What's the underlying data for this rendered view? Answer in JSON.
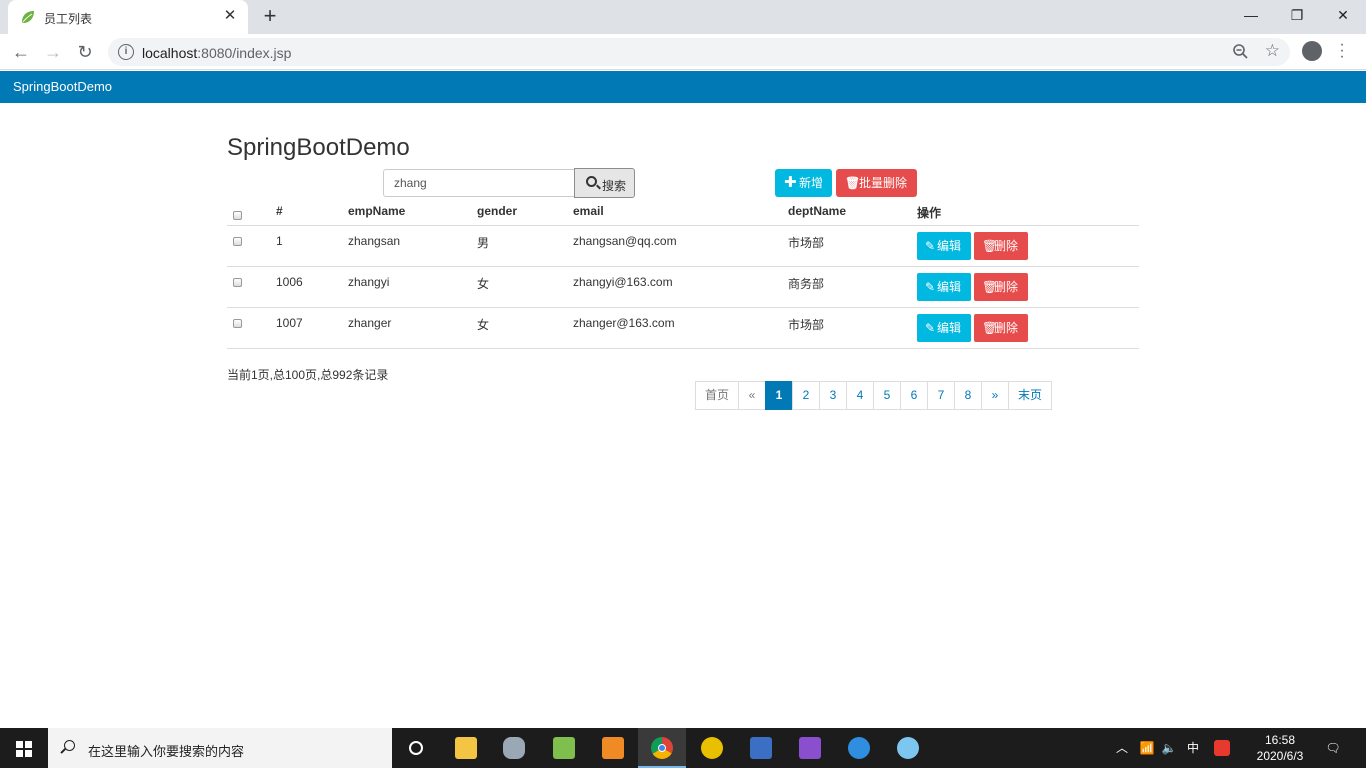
{
  "browser": {
    "tab_title": "员工列表",
    "tab_close": "✕",
    "new_tab": "+",
    "url_host": "localhost",
    "url_rest": ":8080/index.jsp"
  },
  "navbar": {
    "brand": "SpringBootDemo"
  },
  "page": {
    "title": "SpringBootDemo",
    "search_value": "zhang",
    "search_button": "搜索",
    "add_button": "新增",
    "batch_delete_button": "批量删除"
  },
  "table": {
    "headers": [
      "#",
      "empName",
      "gender",
      "email",
      "deptName",
      "操作"
    ],
    "rows": [
      {
        "id": "1",
        "empName": "zhangsan",
        "gender": "男",
        "email": "zhangsan@qq.com",
        "deptName": "市场部"
      },
      {
        "id": "1006",
        "empName": "zhangyi",
        "gender": "女",
        "email": "zhangyi@163.com",
        "deptName": "商务部"
      },
      {
        "id": "1007",
        "empName": "zhanger",
        "gender": "女",
        "email": "zhanger@163.com",
        "deptName": "市场部"
      }
    ],
    "edit_label": "编辑",
    "delete_label": "删除"
  },
  "pagination": {
    "info": "当前1页,总100页,总992条记录",
    "first": "首页",
    "prev": "«",
    "pages": [
      "1",
      "2",
      "3",
      "4",
      "5",
      "6",
      "7",
      "8"
    ],
    "current": "1",
    "next": "»",
    "last": "末页"
  },
  "taskbar": {
    "search_placeholder": "在这里输入你要搜索的内容",
    "ime": "中",
    "time": "16:58",
    "date": "2020/6/3"
  },
  "colors": {
    "navbar": "#0079b5",
    "info": "#00b8e0",
    "danger": "#e74c4c"
  }
}
